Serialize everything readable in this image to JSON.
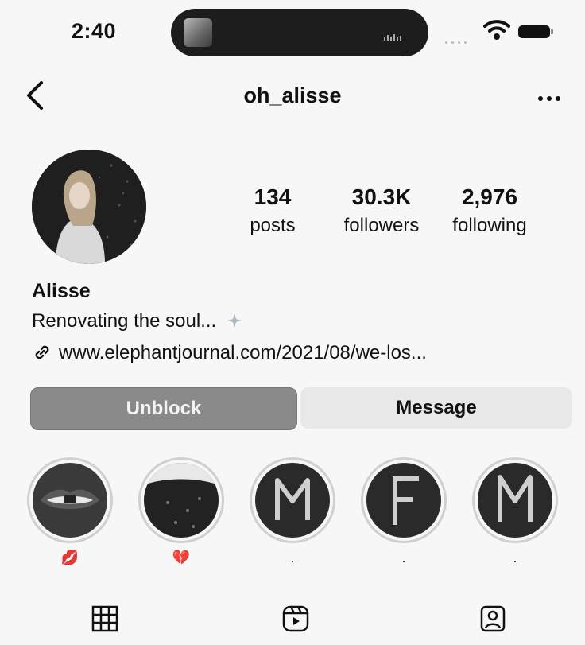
{
  "status": {
    "time": "2:40"
  },
  "header": {
    "username": "oh_alisse"
  },
  "profile": {
    "stats": [
      {
        "value": "134",
        "label": "posts"
      },
      {
        "value": "30.3K",
        "label": "followers"
      },
      {
        "value": "2,976",
        "label": "following"
      }
    ],
    "name": "Alisse",
    "bio": "Renovating the soul...",
    "link": "www.elephantjournal.com/2021/08/we-los..."
  },
  "actions": {
    "unblock_label": "Unblock",
    "message_label": "Message"
  },
  "highlights": [
    {
      "caption": "💋"
    },
    {
      "caption": "💔"
    },
    {
      "caption": "."
    },
    {
      "caption": "."
    },
    {
      "caption": "."
    }
  ],
  "colors": {
    "button_unblock": "#8a8a8a",
    "button_message": "#e8e8e8"
  }
}
